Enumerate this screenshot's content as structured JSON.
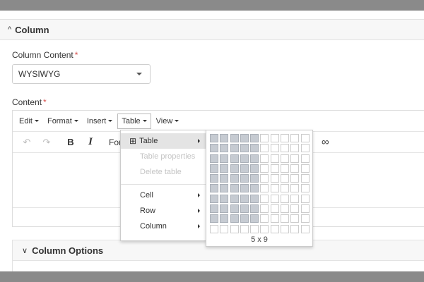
{
  "section": {
    "chevron": "^",
    "title": "Column"
  },
  "column_content": {
    "label": "Column Content",
    "required_mark": "*",
    "selected": "WYSIWYG"
  },
  "content": {
    "label": "Content",
    "required_mark": "*"
  },
  "menubar": {
    "items": [
      {
        "label": "Edit"
      },
      {
        "label": "Format"
      },
      {
        "label": "Insert"
      },
      {
        "label": "Table"
      },
      {
        "label": "View"
      }
    ]
  },
  "toolbar": {
    "undo": "↶",
    "redo": "↷",
    "bold": "B",
    "italic": "I",
    "format_text": "For",
    "link_glyph": "∞"
  },
  "table_menu": {
    "table_icon": "⊞",
    "items": [
      {
        "label": "Table"
      },
      {
        "label": "Table properties"
      },
      {
        "label": "Delete table"
      },
      {
        "label": "Cell"
      },
      {
        "label": "Row"
      },
      {
        "label": "Column"
      }
    ]
  },
  "grid_picker": {
    "rows": 10,
    "cols": 10,
    "selected_rows": 9,
    "selected_cols": 5,
    "label": "5 x 9"
  },
  "column_options": {
    "chevron": "∨",
    "title": "Column Options"
  }
}
